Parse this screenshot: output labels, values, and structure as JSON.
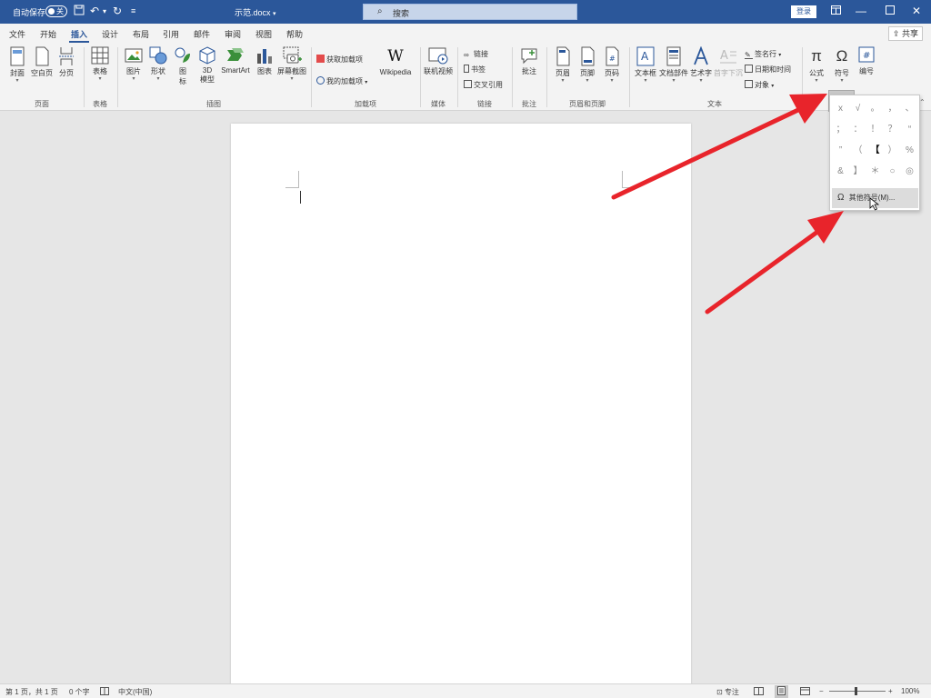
{
  "titlebar": {
    "autosave_label": "自动保存",
    "autosave_state": "关",
    "doc_name": "示范.docx",
    "doc_name_caret": "▾",
    "search_placeholder": "搜索",
    "login_label": "登录"
  },
  "tabs": [
    {
      "label": "文件"
    },
    {
      "label": "开始"
    },
    {
      "label": "插入"
    },
    {
      "label": "设计"
    },
    {
      "label": "布局"
    },
    {
      "label": "引用"
    },
    {
      "label": "邮件"
    },
    {
      "label": "审阅"
    },
    {
      "label": "视图"
    },
    {
      "label": "帮助"
    }
  ],
  "active_tab": "插入",
  "share_label": "共享",
  "ribbon": {
    "pages": {
      "cover": "封面",
      "blank": "空白页",
      "break": "分页",
      "group": "页面"
    },
    "tables": {
      "table": "表格",
      "group": "表格"
    },
    "illustrations": {
      "pictures": "图片",
      "shapes": "形状",
      "icons_1": "图",
      "icons_2": "标",
      "model_1": "3D",
      "model_2": "模型",
      "smartart": "SmartArt",
      "chart": "图表",
      "screenshot": "屏幕截图",
      "group": "插图"
    },
    "addins": {
      "get": "获取加载项",
      "my": "我的加载项",
      "wiki": "Wikipedia",
      "group": "加载项"
    },
    "media": {
      "video": "联机视频",
      "group": "媒体"
    },
    "links": {
      "link": "链接",
      "bookmark": "书签",
      "crossref": "交叉引用",
      "group": "链接"
    },
    "comments": {
      "comment": "批注",
      "group": "批注"
    },
    "headerfooter": {
      "header": "页眉",
      "footer": "页脚",
      "pagenum": "页码",
      "group": "页眉和页脚"
    },
    "text": {
      "textbox": "文本框",
      "quickparts": "文档部件",
      "wordart": "艺术字",
      "dropcap": "首字下沉",
      "signature": "签名行",
      "datetime": "日期和时间",
      "object": "对象",
      "group": "文本"
    },
    "symbols": {
      "equation": "公式",
      "symbol": "符号",
      "number": "编号"
    }
  },
  "symbol_dropdown": {
    "symbols": [
      "x",
      "√",
      "。",
      "，",
      "、",
      "；",
      "：",
      "！",
      "？",
      "“",
      "”",
      "（",
      "【",
      "）",
      "%",
      "&",
      "】",
      "＊",
      "○",
      "◎"
    ],
    "more_label": "其他符号(M)..."
  },
  "statusbar": {
    "page": "第 1 页，共 1 页",
    "words": "0 个字",
    "language": "中文(中国)",
    "focus": "专注",
    "zoom": "100%"
  },
  "colors": {
    "titlebar": "#2b579a",
    "arrow": "#e8242b"
  }
}
